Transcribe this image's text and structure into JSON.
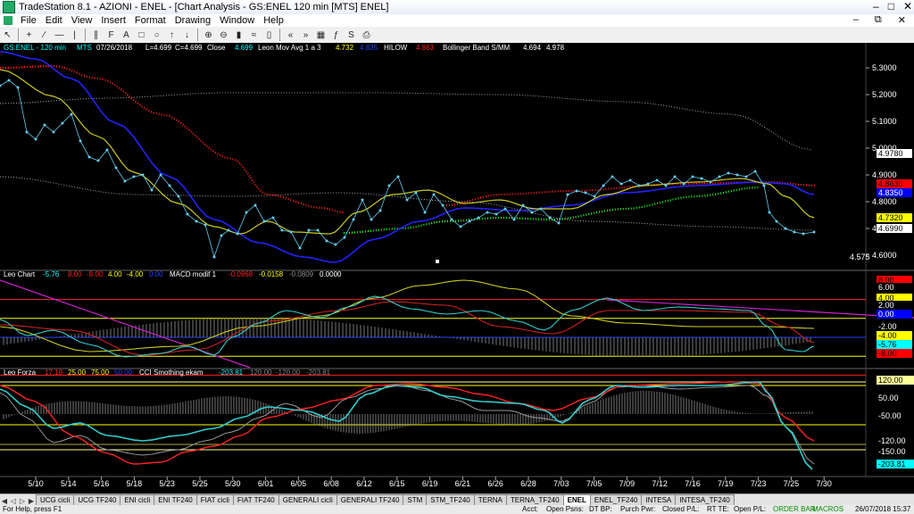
{
  "window": {
    "title": "TradeStation 8.1 - AZIONI - ENEL - [Chart Analysis - GS:ENEL  120 min  [MTS] ENEL]"
  },
  "menu": [
    "File",
    "Edit",
    "View",
    "Insert",
    "Format",
    "Drawing",
    "Window",
    "Help"
  ],
  "header": {
    "symbol": "GS:ENEL - 120 min",
    "feed": "MTS",
    "date": "07/26/2018",
    "low": "L=4.699",
    "close": "C=4.699",
    "close_label": "Close",
    "close_value": "4.699",
    "leon_label": "Leon Mov Avg 1 a 3",
    "leon_v1": "4.732",
    "leon_v2": "4.835",
    "hilow_label": "HILOW",
    "hilow_value": "4.863",
    "bb_label": "Bollinger Band S/MM",
    "bb_v1": "4.694",
    "bb_v2": "4.978"
  },
  "price_axis": {
    "ticks": [
      "5.3000",
      "5.2000",
      "5.1000",
      "5.0000",
      "4.9000",
      "4.8000",
      "4.7000",
      "4.6000"
    ],
    "tags": [
      {
        "label": "4.9780",
        "color": "#ffffff",
        "text": "#000000"
      },
      {
        "label": "4.8630",
        "color": "#ff0000",
        "text": "#000000"
      },
      {
        "label": "4.8350",
        "color": "#0000ff",
        "text": "#ffffff"
      },
      {
        "label": "4.7320",
        "color": "#ffff00",
        "text": "#000000"
      },
      {
        "label": "4.6990",
        "color": "#ffffff",
        "text": "#000000"
      }
    ],
    "low_annotation": "4.575"
  },
  "leo_chart": {
    "title": "Leo Chart",
    "v1": "-5.76",
    "v2": "8.00",
    "v3": "-8.00",
    "v4": "4.00",
    "v5": "-4.00",
    "v6": "0.00",
    "macd_label": "MACD modif 1",
    "m1": "-0.0968",
    "m2": "-0.0158",
    "m3": "-0.0809",
    "m4": "0.0000",
    "axis_tags": [
      {
        "label": "8.00",
        "color": "#ff0000",
        "text": "#000000"
      },
      {
        "label": "6.00",
        "color": "#000000",
        "text": "#ffffff"
      },
      {
        "label": "4.00",
        "color": "#ffff00",
        "text": "#000000"
      },
      {
        "label": "2.00",
        "color": "#000000",
        "text": "#ffffff"
      },
      {
        "label": "0.00",
        "color": "#0000ff",
        "text": "#ffffff"
      },
      {
        "label": "-2.00",
        "color": "#000000",
        "text": "#ffffff"
      },
      {
        "label": "-4.00",
        "color": "#ffff00",
        "text": "#000000"
      },
      {
        "label": "-5.76",
        "color": "#00ffff",
        "text": "#000000"
      },
      {
        "label": "-8.00",
        "color": "#ff0000",
        "text": "#000000"
      }
    ]
  },
  "leo_forza": {
    "title": "Leo Forza",
    "v1": "17.19",
    "v2": "25.00",
    "v3": "75.00",
    "v4": "50.00",
    "cci_label": "CCI Smothing ekam",
    "c1": "-203.81",
    "c2": "120.00",
    "c3": "-120.00",
    "c4": "-203.81",
    "axis_tags": [
      {
        "label": "120.00",
        "color": "#ffff99",
        "text": "#000000"
      },
      {
        "label": "50.00",
        "color": "#000000",
        "text": "#ffffff"
      },
      {
        "label": "-50.00",
        "color": "#000000",
        "text": "#ffffff"
      },
      {
        "label": "-120.00",
        "color": "#000000",
        "text": "#ffffff"
      },
      {
        "label": "-150.00",
        "color": "#000000",
        "text": "#ffffff"
      },
      {
        "label": "-203.81",
        "color": "#00ffff",
        "text": "#000000"
      }
    ]
  },
  "x_axis": [
    "5/10",
    "5/14",
    "5/16",
    "5/18",
    "5/23",
    "5/25",
    "5/30",
    "6/01",
    "6/05",
    "6/08",
    "6/12",
    "6/15",
    "6/19",
    "6/21",
    "6/26",
    "6/28",
    "7/03",
    "7/05",
    "7/09",
    "7/12",
    "7/16",
    "7/19",
    "7/23",
    "7/25",
    "7/30"
  ],
  "tabs": [
    "UCG cicli",
    "UCG TF240",
    "ENI cicli",
    "ENI TF240",
    "FIAT cicli",
    "FIAT TF240",
    "GENERALI cicli",
    "GENERALI TF240",
    "STM",
    "STM_TF240",
    "TERNA",
    "TERNA_TF240",
    "ENEL",
    "ENEL_TF240",
    "INTESA",
    "INTESA_TF240"
  ],
  "active_tab": "ENEL",
  "status": {
    "help": "For Help, press F1",
    "acct": "Acct:",
    "open_psns": "Open Psns:",
    "dt_bp": "DT BP:",
    "purch_pwr": "Purch Pwr:",
    "closed_pl": "Closed P/L:",
    "rt_te": "RT TE:",
    "open_pl": "Open P/L:",
    "order_bar": "ORDER BAR",
    "macros": "MACROS",
    "datetime": "26/07/2018 15:37"
  },
  "colors": {
    "price_dots": "#66ccee",
    "blue_ma": "#2222ff",
    "yellow_ma": "#cccc22",
    "red_dots": "#ff2222",
    "green_dots": "#22ff22",
    "bb_gray": "#aaaaaa",
    "magenta_trend": "#cc22cc",
    "cyan_osc": "#33cccc"
  }
}
